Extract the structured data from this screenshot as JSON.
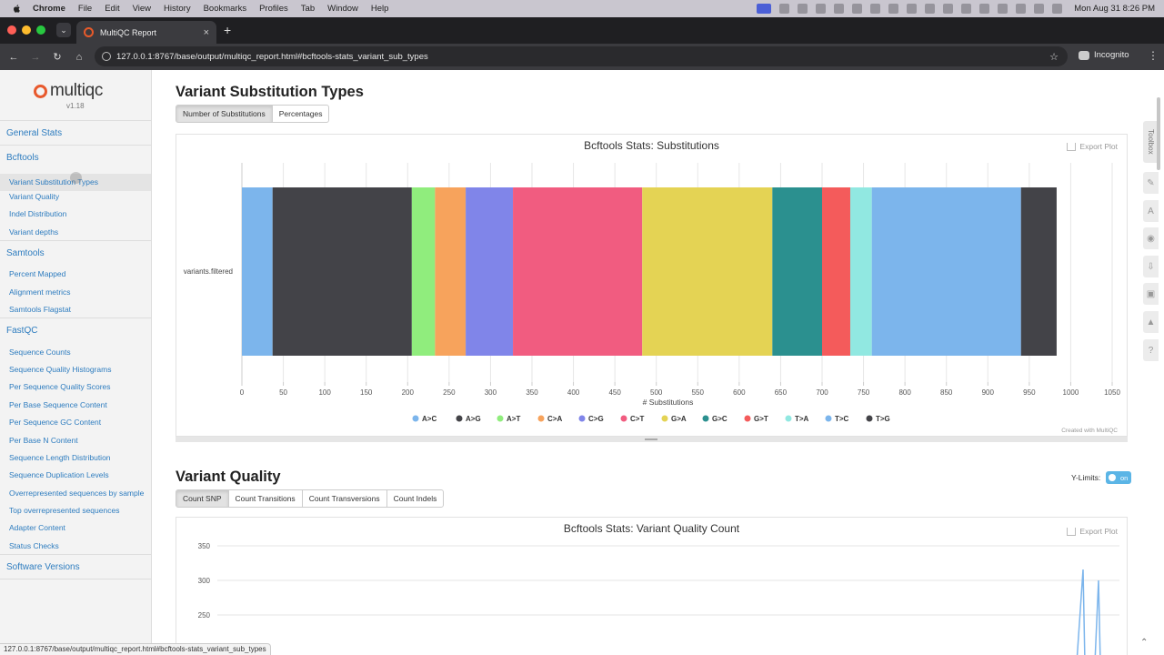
{
  "menubar": {
    "app": "Chrome",
    "items": [
      "File",
      "Edit",
      "View",
      "History",
      "Bookmarks",
      "Profiles",
      "Tab",
      "Window",
      "Help"
    ],
    "clock": "Mon Aug 31  8:26 PM"
  },
  "browser": {
    "tab_title": "MultiQC Report",
    "url": "127.0.0.1:8767/base/output/multiqc_report.html#bcftools-stats_variant_sub_types",
    "incognito_label": "Incognito",
    "status_url": "127.0.0.1:8767/base/output/multiqc_report.html#bcftools-stats_variant_sub_types"
  },
  "sidebar": {
    "logo": "multiqc",
    "version": "v1.18",
    "general_stats": "General Stats",
    "bcftools": {
      "label": "Bcftools",
      "items": [
        "Variant Substitution Types",
        "Variant Quality",
        "Indel Distribution",
        "Variant depths"
      ]
    },
    "samtools": {
      "label": "Samtools",
      "items": [
        "Percent Mapped",
        "Alignment metrics",
        "Samtools Flagstat"
      ]
    },
    "fastqc": {
      "label": "FastQC",
      "items": [
        "Sequence Counts",
        "Sequence Quality Histograms",
        "Per Sequence Quality Scores",
        "Per Base Sequence Content",
        "Per Sequence GC Content",
        "Per Base N Content",
        "Sequence Length Distribution",
        "Sequence Duplication Levels",
        "Overrepresented sequences by sample",
        "Top overrepresented sequences",
        "Adapter Content",
        "Status Checks"
      ]
    },
    "software_versions": "Software Versions"
  },
  "section1": {
    "heading": "Variant Substitution Types",
    "buttons": [
      "Number of Substitutions",
      "Percentages"
    ],
    "active_button": 0,
    "export_label": "Export Plot",
    "credit": "Created with MultiQC"
  },
  "section2": {
    "heading": "Variant Quality",
    "buttons": [
      "Count SNP",
      "Count Transitions",
      "Count Transversions",
      "Count Indels"
    ],
    "active_button": 0,
    "export_label": "Export Plot",
    "ylimits_label": "Y-Limits:",
    "ylimits_toggle": "on"
  },
  "toolbox_label": "Toolbox",
  "chart_data": [
    {
      "type": "bar",
      "orientation": "horizontal-stacked",
      "title": "Bcftools Stats: Substitutions",
      "xlabel": "# Substitutions",
      "ylabel": "",
      "categories": [
        "variants.filtered"
      ],
      "xlim": [
        0,
        1050
      ],
      "xticks": [
        0,
        50,
        100,
        150,
        200,
        250,
        300,
        350,
        400,
        450,
        500,
        550,
        600,
        650,
        700,
        750,
        800,
        850,
        900,
        950,
        1000,
        1050
      ],
      "legend_position": "bottom",
      "grid": true,
      "series": [
        {
          "name": "A>C",
          "values": [
            37
          ],
          "color": "#7cb5ec"
        },
        {
          "name": "A>G",
          "values": [
            168
          ],
          "color": "#434348"
        },
        {
          "name": "A>T",
          "values": [
            28
          ],
          "color": "#90ed7d"
        },
        {
          "name": "C>A",
          "values": [
            37
          ],
          "color": "#f7a35c"
        },
        {
          "name": "C>G",
          "values": [
            57
          ],
          "color": "#8085e9"
        },
        {
          "name": "C>T",
          "values": [
            156
          ],
          "color": "#f15c80"
        },
        {
          "name": "G>A",
          "values": [
            157
          ],
          "color": "#e4d354"
        },
        {
          "name": "G>C",
          "values": [
            60
          ],
          "color": "#2b908f"
        },
        {
          "name": "G>T",
          "values": [
            34
          ],
          "color": "#f45b5b"
        },
        {
          "name": "T>A",
          "values": [
            26
          ],
          "color": "#91e8e1"
        },
        {
          "name": "T>C",
          "values": [
            180
          ],
          "color": "#7cb5ec"
        },
        {
          "name": "T>G",
          "values": [
            43
          ],
          "color": "#434348"
        }
      ]
    },
    {
      "type": "line",
      "title": "Bcftools Stats: Variant Quality Count",
      "yticks": [
        250,
        300,
        350
      ],
      "grid": true
    }
  ]
}
